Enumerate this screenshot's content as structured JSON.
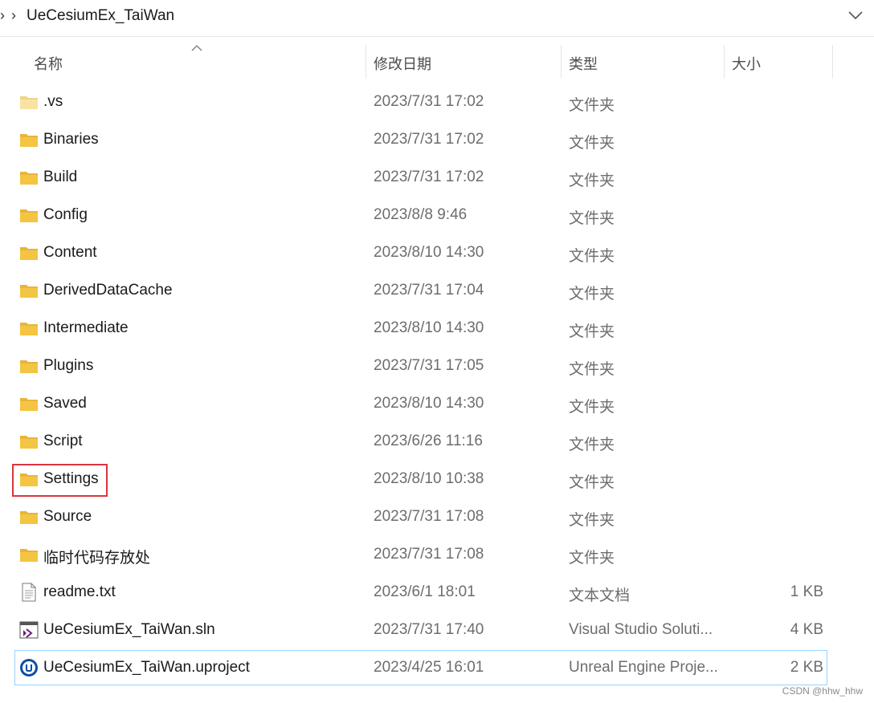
{
  "address_bar": {
    "crumb": "UeCesiumEx_TaiWan",
    "icons": [
      "chevron-right-icon",
      "chevron-down-icon"
    ]
  },
  "columns": {
    "name": "名称",
    "date": "修改日期",
    "type": "类型",
    "size": "大小"
  },
  "files": [
    {
      "name": ".vs",
      "date": "2023/7/31 17:02",
      "type": "文件夹",
      "size": "",
      "icon": "folder-light-icon"
    },
    {
      "name": "Binaries",
      "date": "2023/7/31 17:02",
      "type": "文件夹",
      "size": "",
      "icon": "folder-icon"
    },
    {
      "name": "Build",
      "date": "2023/7/31 17:02",
      "type": "文件夹",
      "size": "",
      "icon": "folder-icon"
    },
    {
      "name": "Config",
      "date": "2023/8/8 9:46",
      "type": "文件夹",
      "size": "",
      "icon": "folder-icon"
    },
    {
      "name": "Content",
      "date": "2023/8/10 14:30",
      "type": "文件夹",
      "size": "",
      "icon": "folder-icon"
    },
    {
      "name": "DerivedDataCache",
      "date": "2023/7/31 17:04",
      "type": "文件夹",
      "size": "",
      "icon": "folder-icon"
    },
    {
      "name": "Intermediate",
      "date": "2023/8/10 14:30",
      "type": "文件夹",
      "size": "",
      "icon": "folder-icon"
    },
    {
      "name": "Plugins",
      "date": "2023/7/31 17:05",
      "type": "文件夹",
      "size": "",
      "icon": "folder-icon"
    },
    {
      "name": "Saved",
      "date": "2023/8/10 14:30",
      "type": "文件夹",
      "size": "",
      "icon": "folder-icon"
    },
    {
      "name": "Script",
      "date": "2023/6/26 11:16",
      "type": "文件夹",
      "size": "",
      "icon": "folder-icon"
    },
    {
      "name": "Settings",
      "date": "2023/8/10 10:38",
      "type": "文件夹",
      "size": "",
      "icon": "folder-icon"
    },
    {
      "name": "Source",
      "date": "2023/7/31 17:08",
      "type": "文件夹",
      "size": "",
      "icon": "folder-icon"
    },
    {
      "name": "临时代码存放处",
      "date": "2023/7/31 17:08",
      "type": "文件夹",
      "size": "",
      "icon": "folder-icon"
    },
    {
      "name": "readme.txt",
      "date": "2023/6/1 18:01",
      "type": "文本文档",
      "size": "1 KB",
      "icon": "text-file-icon"
    },
    {
      "name": "UeCesiumEx_TaiWan.sln",
      "date": "2023/7/31 17:40",
      "type": "Visual Studio Soluti...",
      "size": "4 KB",
      "icon": "visual-studio-solution-icon"
    },
    {
      "name": "UeCesiumEx_TaiWan.uproject",
      "date": "2023/4/25 16:01",
      "type": "Unreal Engine Proje...",
      "size": "2 KB",
      "icon": "unreal-engine-icon"
    }
  ],
  "watermark": "CSDN @hhw_hhw",
  "colors": {
    "folder": "#f4c542",
    "folder_light": "#f8e3a3",
    "selection_border": "#99d1ff",
    "annotation_box": "#d9363e"
  }
}
